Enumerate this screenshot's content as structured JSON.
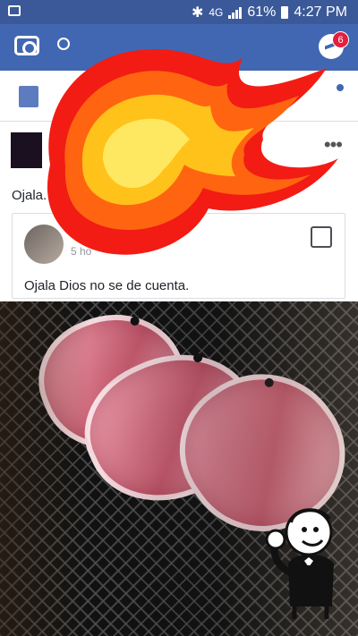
{
  "status_bar": {
    "network": "4G",
    "battery": "61%",
    "time": "4:27 PM"
  },
  "nav": {
    "messenger_badge": "6"
  },
  "post": {
    "text": "Ojala.",
    "shared_post": {
      "time": "5 ho",
      "text": "Ojala Dios no se de cuenta."
    }
  },
  "colors": {
    "facebook_blue": "#4267b2",
    "status_blue": "#3b5998",
    "badge_red": "#e41e3f"
  }
}
